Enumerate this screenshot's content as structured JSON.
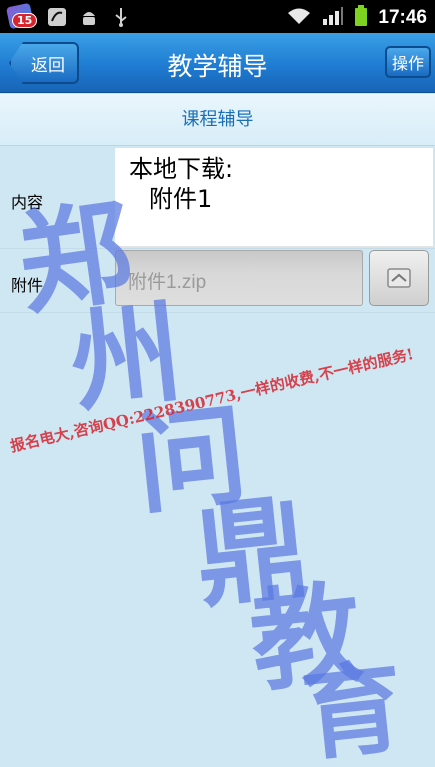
{
  "status_bar": {
    "badge_count": "15",
    "time": "17:46"
  },
  "header": {
    "back_label": "返回",
    "title": "教学辅导",
    "action_label": "操作"
  },
  "section": {
    "title": "课程辅导"
  },
  "form": {
    "content_label": "内容",
    "content_line1": "本地下载:",
    "content_line2": "附件1",
    "attachment_label": "附件",
    "attachment_value": "附件1.zip"
  },
  "watermark": {
    "line": "报名电大,咨询QQ:2228390773,一样的收费,不一样的服务!",
    "chars": [
      "郑",
      "州",
      "问",
      "鼎",
      "教",
      "育"
    ]
  },
  "colors": {
    "title_bar": "#1f7cd2",
    "background": "#cfe6f3",
    "section_text": "#1b6fb8",
    "watermark_blue": "#5a78e1",
    "watermark_red": "#d7232d"
  }
}
